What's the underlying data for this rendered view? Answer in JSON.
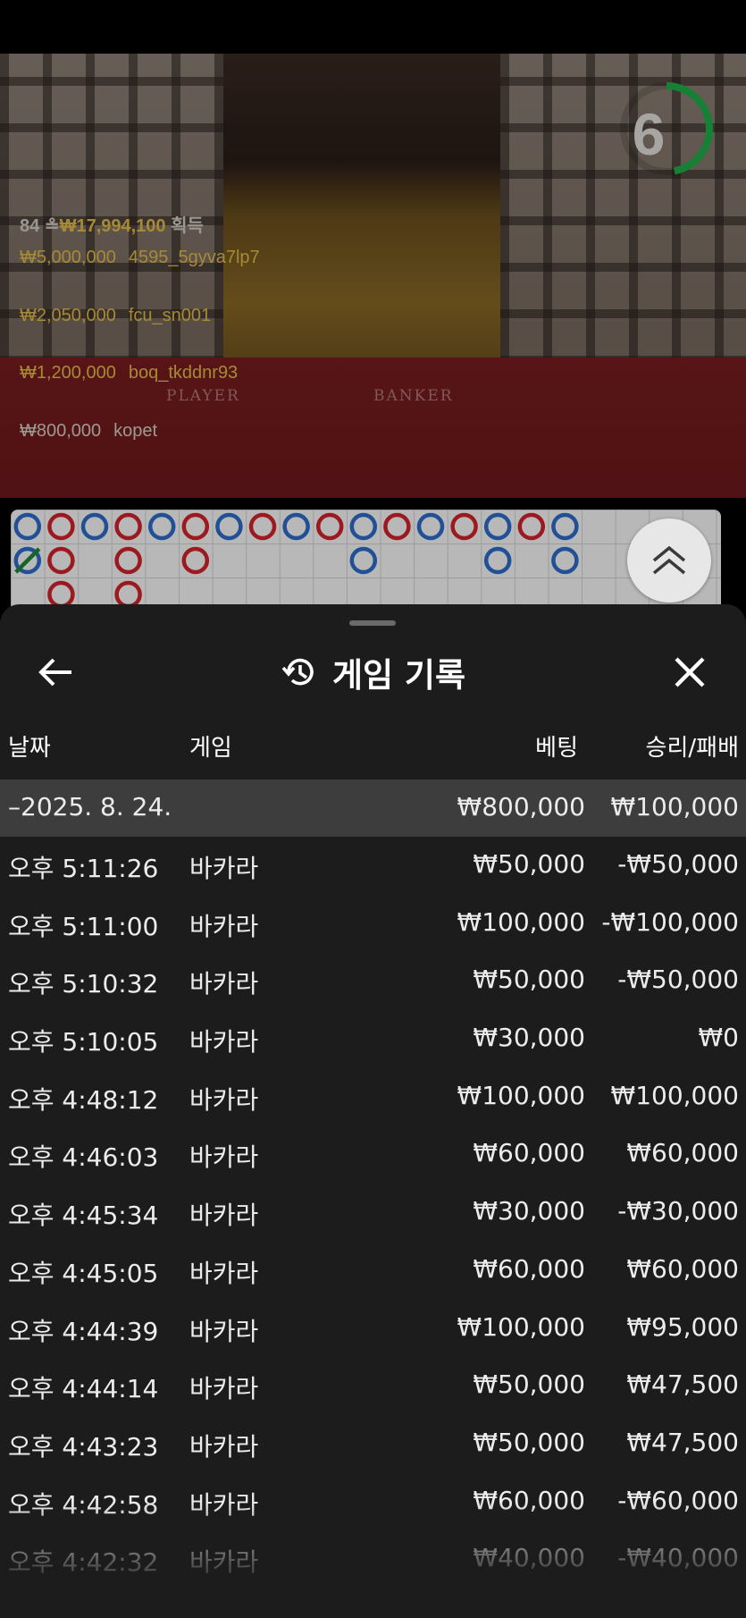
{
  "video": {
    "countdown": "6",
    "total_winners": "84",
    "total_amount": "₩17,994,100",
    "total_suffix": "획득",
    "top_winners": [
      {
        "amount": "₩5,000,000",
        "user": "4595_5gyva7lp7"
      },
      {
        "amount": "₩2,050,000",
        "user": "fcu_sn001"
      },
      {
        "amount": "₩1,200,000",
        "user": "boq_tkddnr93"
      },
      {
        "amount": "₩800,000",
        "user": "kopet"
      }
    ],
    "felt_player": "PLAYER",
    "felt_banker": "BANKER",
    "colors": {
      "timer": "#1fb24a",
      "banker": "#d9252b",
      "player": "#2e6fd0",
      "tie": "#1e8c3a",
      "gold": "#e6c04a"
    }
  },
  "roadmap": {
    "columns": [
      [
        "P",
        "T"
      ],
      [
        "B",
        "B",
        "B"
      ],
      [
        "P"
      ],
      [
        "B",
        "B",
        "B"
      ],
      [
        "P"
      ],
      [
        "B",
        "B"
      ],
      [
        "P"
      ],
      [
        "B"
      ],
      [
        "P"
      ],
      [
        "B"
      ],
      [
        "P",
        "P"
      ],
      [
        "B"
      ],
      [
        "P"
      ],
      [
        "B"
      ],
      [
        "P",
        "P"
      ],
      [
        "B"
      ],
      [
        "P",
        "P"
      ]
    ]
  },
  "sheet": {
    "title": "게임 기록",
    "headers": {
      "date": "날짜",
      "game": "게임",
      "bet": "베팅",
      "result": "승리/패배"
    },
    "group": {
      "date": "–2025. 8. 24.",
      "bet": "₩800,000",
      "result": "₩100,000"
    },
    "rows": [
      {
        "time": "오후 5:11:26",
        "game": "바카라",
        "bet": "₩50,000",
        "result": "-₩50,000"
      },
      {
        "time": "오후 5:11:00",
        "game": "바카라",
        "bet": "₩100,000",
        "result": "-₩100,000"
      },
      {
        "time": "오후 5:10:32",
        "game": "바카라",
        "bet": "₩50,000",
        "result": "-₩50,000"
      },
      {
        "time": "오후 5:10:05",
        "game": "바카라",
        "bet": "₩30,000",
        "result": "₩0"
      },
      {
        "time": "오후 4:48:12",
        "game": "바카라",
        "bet": "₩100,000",
        "result": "₩100,000"
      },
      {
        "time": "오후 4:46:03",
        "game": "바카라",
        "bet": "₩60,000",
        "result": "₩60,000"
      },
      {
        "time": "오후 4:45:34",
        "game": "바카라",
        "bet": "₩30,000",
        "result": "-₩30,000"
      },
      {
        "time": "오후 4:45:05",
        "game": "바카라",
        "bet": "₩60,000",
        "result": "₩60,000"
      },
      {
        "time": "오후 4:44:39",
        "game": "바카라",
        "bet": "₩100,000",
        "result": "₩95,000"
      },
      {
        "time": "오후 4:44:14",
        "game": "바카라",
        "bet": "₩50,000",
        "result": "₩47,500"
      },
      {
        "time": "오후 4:43:23",
        "game": "바카라",
        "bet": "₩50,000",
        "result": "₩47,500"
      },
      {
        "time": "오후 4:42:58",
        "game": "바카라",
        "bet": "₩60,000",
        "result": "-₩60,000"
      },
      {
        "time": "오후 4:42:32",
        "game": "바카라",
        "bet": "₩40,000",
        "result": "-₩40,000"
      }
    ]
  }
}
